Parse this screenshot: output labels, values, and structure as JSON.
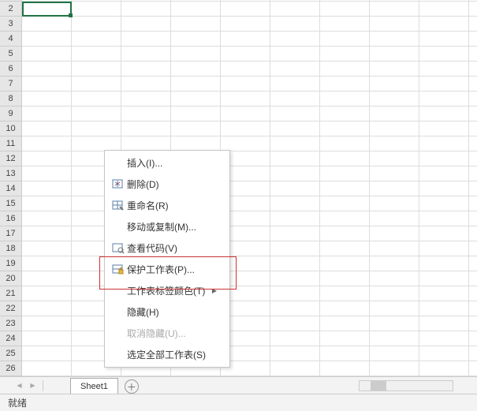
{
  "rows": [
    "2",
    "3",
    "4",
    "5",
    "6",
    "7",
    "8",
    "9",
    "10",
    "11",
    "12",
    "13",
    "14",
    "15",
    "16",
    "17",
    "18",
    "19",
    "20",
    "21",
    "22",
    "23",
    "24",
    "25",
    "26"
  ],
  "menu": {
    "insert": "插入(I)...",
    "delete": "删除(D)",
    "rename": "重命名(R)",
    "move_copy": "移动或复制(M)...",
    "view_code": "查看代码(V)",
    "protect_sheet": "保护工作表(P)...",
    "tab_color": "工作表标签颜色(T)",
    "hide": "隐藏(H)",
    "unhide": "取消隐藏(U)...",
    "select_all": "选定全部工作表(S)"
  },
  "sheet": {
    "name": "Sheet1"
  },
  "status": {
    "ready": "就绪"
  },
  "glyphs": {
    "arrow_left": "◀",
    "arrow_right": "▶",
    "plus": "＋",
    "submenu": "▶"
  }
}
